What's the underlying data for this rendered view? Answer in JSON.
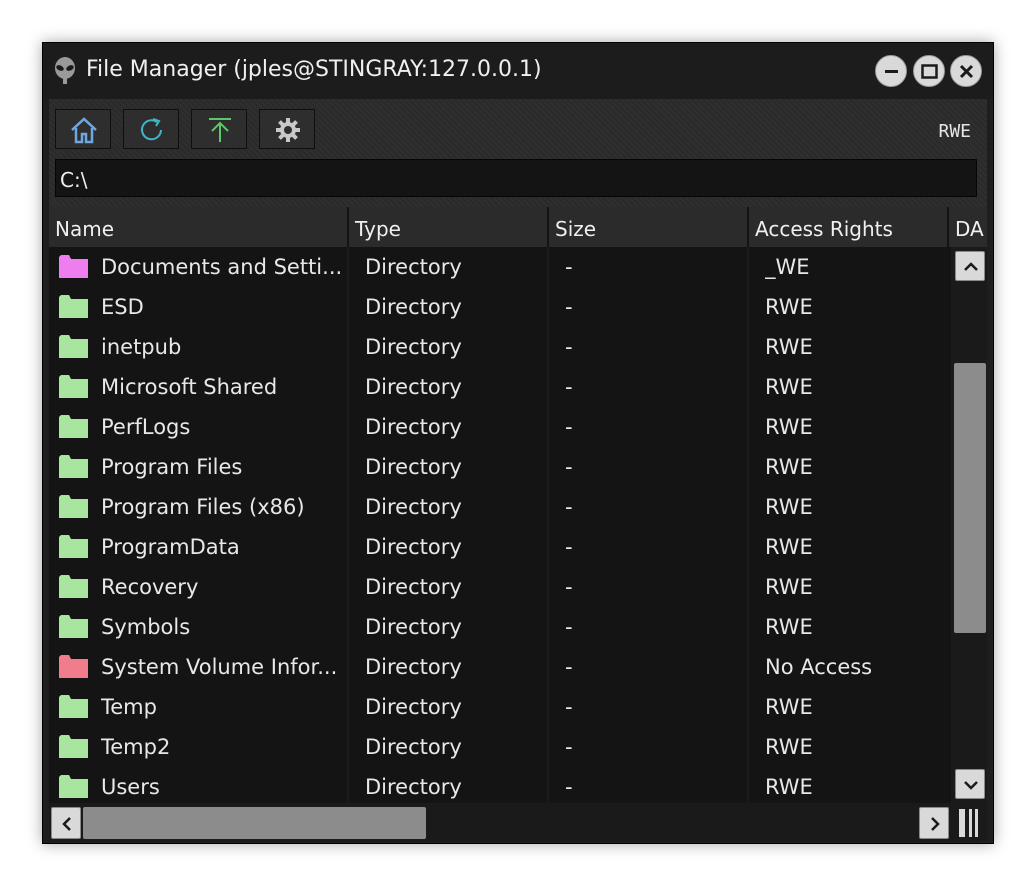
{
  "window": {
    "title": "File Manager (jples@STINGRAY:127.0.0.1)",
    "app_icon": "alien-icon",
    "controls": [
      "minimize-icon",
      "maximize-icon",
      "close-icon"
    ]
  },
  "toolbar": {
    "buttons": [
      {
        "name": "home",
        "icon": "home-icon"
      },
      {
        "name": "refresh",
        "icon": "refresh-icon"
      },
      {
        "name": "up",
        "icon": "arrow-up-icon"
      },
      {
        "name": "settings",
        "icon": "gear-icon"
      }
    ],
    "rights": "RWE"
  },
  "path": {
    "value": "C:\\"
  },
  "table": {
    "columns": [
      "Name",
      "Type",
      "Size",
      "Access Rights",
      "DA"
    ],
    "rows": [
      {
        "name": "Documents and Setti...",
        "type": "Directory",
        "size": "-",
        "rights": "_WE",
        "folder_color": "#ee7ef0"
      },
      {
        "name": "ESD",
        "type": "Directory",
        "size": "-",
        "rights": "RWE",
        "folder_color": "#a8e6a0"
      },
      {
        "name": "inetpub",
        "type": "Directory",
        "size": "-",
        "rights": "RWE",
        "folder_color": "#a8e6a0"
      },
      {
        "name": "Microsoft Shared",
        "type": "Directory",
        "size": "-",
        "rights": "RWE",
        "folder_color": "#a8e6a0"
      },
      {
        "name": "PerfLogs",
        "type": "Directory",
        "size": "-",
        "rights": "RWE",
        "folder_color": "#a8e6a0"
      },
      {
        "name": "Program Files",
        "type": "Directory",
        "size": "-",
        "rights": "RWE",
        "folder_color": "#a8e6a0"
      },
      {
        "name": "Program Files (x86)",
        "type": "Directory",
        "size": "-",
        "rights": "RWE",
        "folder_color": "#a8e6a0"
      },
      {
        "name": "ProgramData",
        "type": "Directory",
        "size": "-",
        "rights": "RWE",
        "folder_color": "#a8e6a0"
      },
      {
        "name": "Recovery",
        "type": "Directory",
        "size": "-",
        "rights": "RWE",
        "folder_color": "#a8e6a0"
      },
      {
        "name": "Symbols",
        "type": "Directory",
        "size": "-",
        "rights": "RWE",
        "folder_color": "#a8e6a0"
      },
      {
        "name": "System Volume Infor...",
        "type": "Directory",
        "size": "-",
        "rights": "No Access",
        "folder_color": "#f07c8c"
      },
      {
        "name": "Temp",
        "type": "Directory",
        "size": "-",
        "rights": "RWE",
        "folder_color": "#a8e6a0"
      },
      {
        "name": "Temp2",
        "type": "Directory",
        "size": "-",
        "rights": "RWE",
        "folder_color": "#a8e6a0"
      },
      {
        "name": "Users",
        "type": "Directory",
        "size": "-",
        "rights": "RWE",
        "folder_color": "#a8e6a0"
      }
    ]
  },
  "colors": {
    "accent_refresh": "#3fb6c8",
    "accent_up": "#5cc86a",
    "home_icon": "#6fa8e0"
  }
}
